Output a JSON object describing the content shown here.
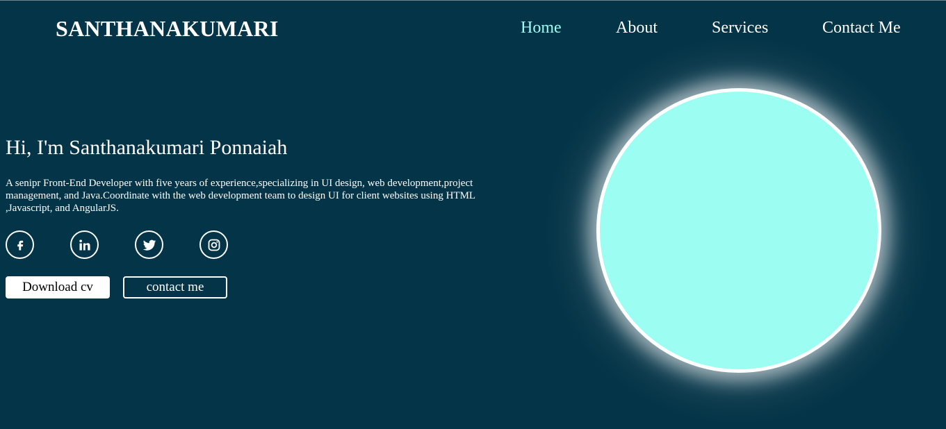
{
  "brand": {
    "name": "SANTHANAKUMARI"
  },
  "nav": {
    "items": [
      {
        "label": "Home",
        "active": true
      },
      {
        "label": "About",
        "active": false
      },
      {
        "label": "Services",
        "active": false
      },
      {
        "label": "Contact Me",
        "active": false
      }
    ]
  },
  "hero": {
    "title": "Hi, I'm Santhanakumari Ponnaiah",
    "description": "A senipr Front-End Developer with five years of experience,specializing in UI design, web development,project management, and Java.Coordinate with the web development team to design UI for client websites using HTML ,Javascript, and AngularJS.",
    "socials": [
      {
        "icon": "facebook-icon"
      },
      {
        "icon": "linkedin-icon"
      },
      {
        "icon": "twitter-icon"
      },
      {
        "icon": "instagram-icon"
      }
    ],
    "buttons": {
      "download": "Download cv",
      "contact": "contact me"
    }
  },
  "colors": {
    "background": "#043447",
    "accent": "#9cfef3",
    "text": "#ffffff"
  }
}
